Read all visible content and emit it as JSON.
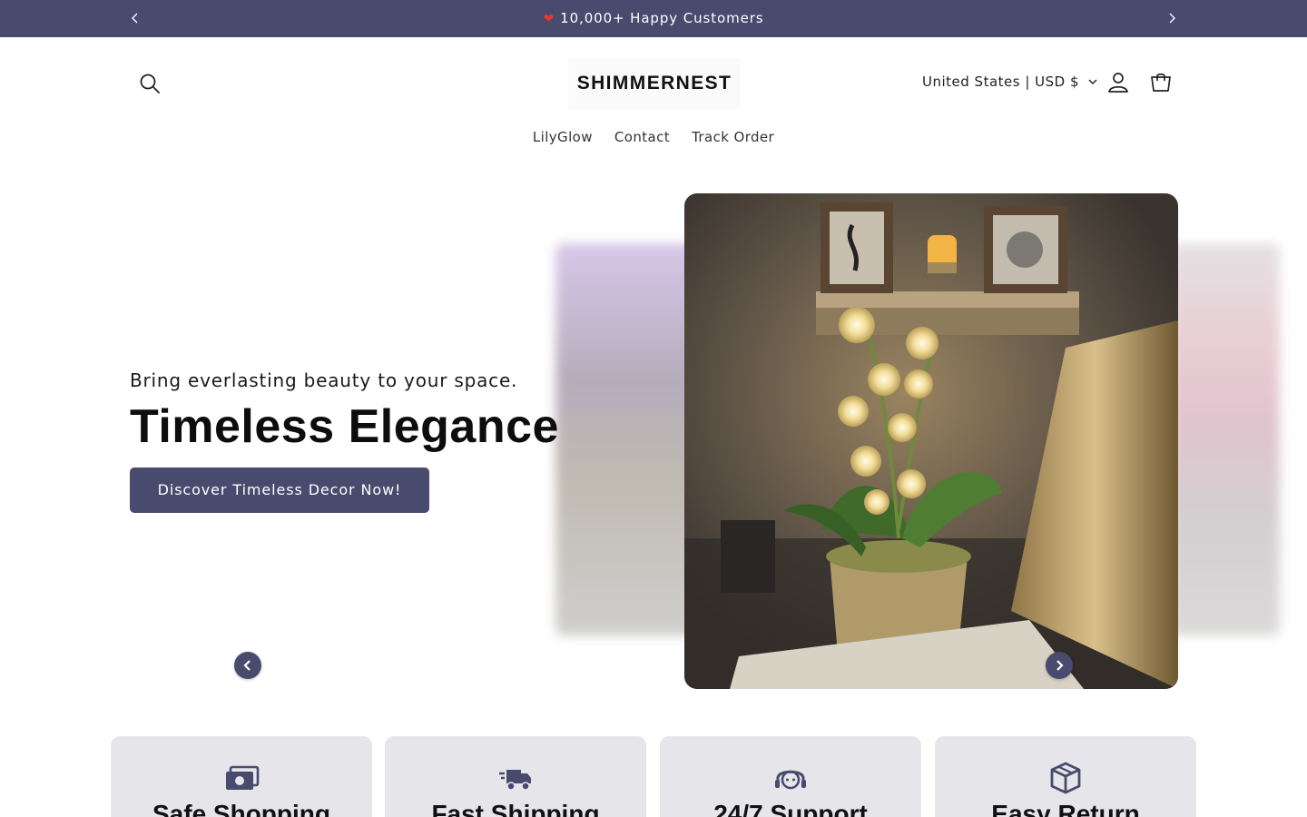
{
  "announcement": {
    "text": "10,000+ Happy Customers",
    "heart_icon": "heart-emoji-icon",
    "prev_icon": "chevron-left-icon",
    "next_icon": "chevron-right-icon"
  },
  "header": {
    "logo_text": "SHIMMERNEST",
    "currency_label": "United States | USD $",
    "icons": [
      "search-icon",
      "account-icon",
      "cart-icon"
    ]
  },
  "nav": {
    "items": [
      "LilyGlow",
      "Contact",
      "Track Order"
    ]
  },
  "hero": {
    "subheading": "Bring everlasting beauty to your space.",
    "title": "Timeless Elegance",
    "button_label": "Discover Timeless Decor Now!",
    "image_alt": "Crocheted lily of the valley lamp in a pot on a desk"
  },
  "features": [
    {
      "title": "Safe Shopping",
      "icon": "money-icon"
    },
    {
      "title": "Fast Shipping",
      "icon": "delivery-truck-icon"
    },
    {
      "title": "24/7 Support",
      "icon": "support-headset-icon"
    },
    {
      "title": "Easy Return",
      "icon": "box-icon"
    }
  ],
  "colors": {
    "accent": "#484a6e",
    "announcement_bg": "#484a6e",
    "feature_bg": "#e5e5ea"
  }
}
